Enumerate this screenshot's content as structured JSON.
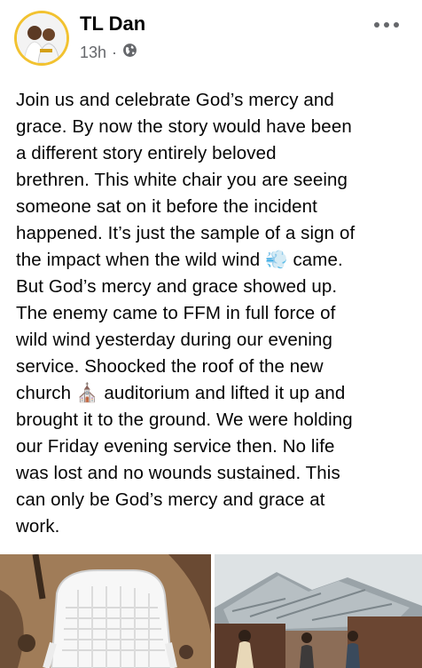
{
  "post": {
    "author": "TL Dan",
    "timestamp": "13h",
    "separator": "·",
    "privacy_icon": "globe-icon",
    "more_icon": "more-horizontal-icon",
    "text": "Join us and celebrate God’s mercy and\ngrace. By now the story would have been\na different story entirely beloved\nbrethren. This white chair you are seeing\nsomeone sat on it before the incident\nhappened. It’s just the sample of a sign of\nthe impact when the wild wind 💨 came.\nBut God’s mercy and grace showed up.\nThe enemy came to FFM in full force of\nwild wind yesterday during our evening\nservice. Shoocked the roof of the new\nchurch ⛪ auditorium and lifted it up and\nbrought it to the ground. We were holding\nour Friday evening service then. No life\nwas lost and no wounds sustained. This\ncan only be God’s mercy and grace at\nwork."
  },
  "photos": [
    {
      "subject": "white plastic chair on ground"
    },
    {
      "subject": "collapsed metal roof with people"
    }
  ]
}
